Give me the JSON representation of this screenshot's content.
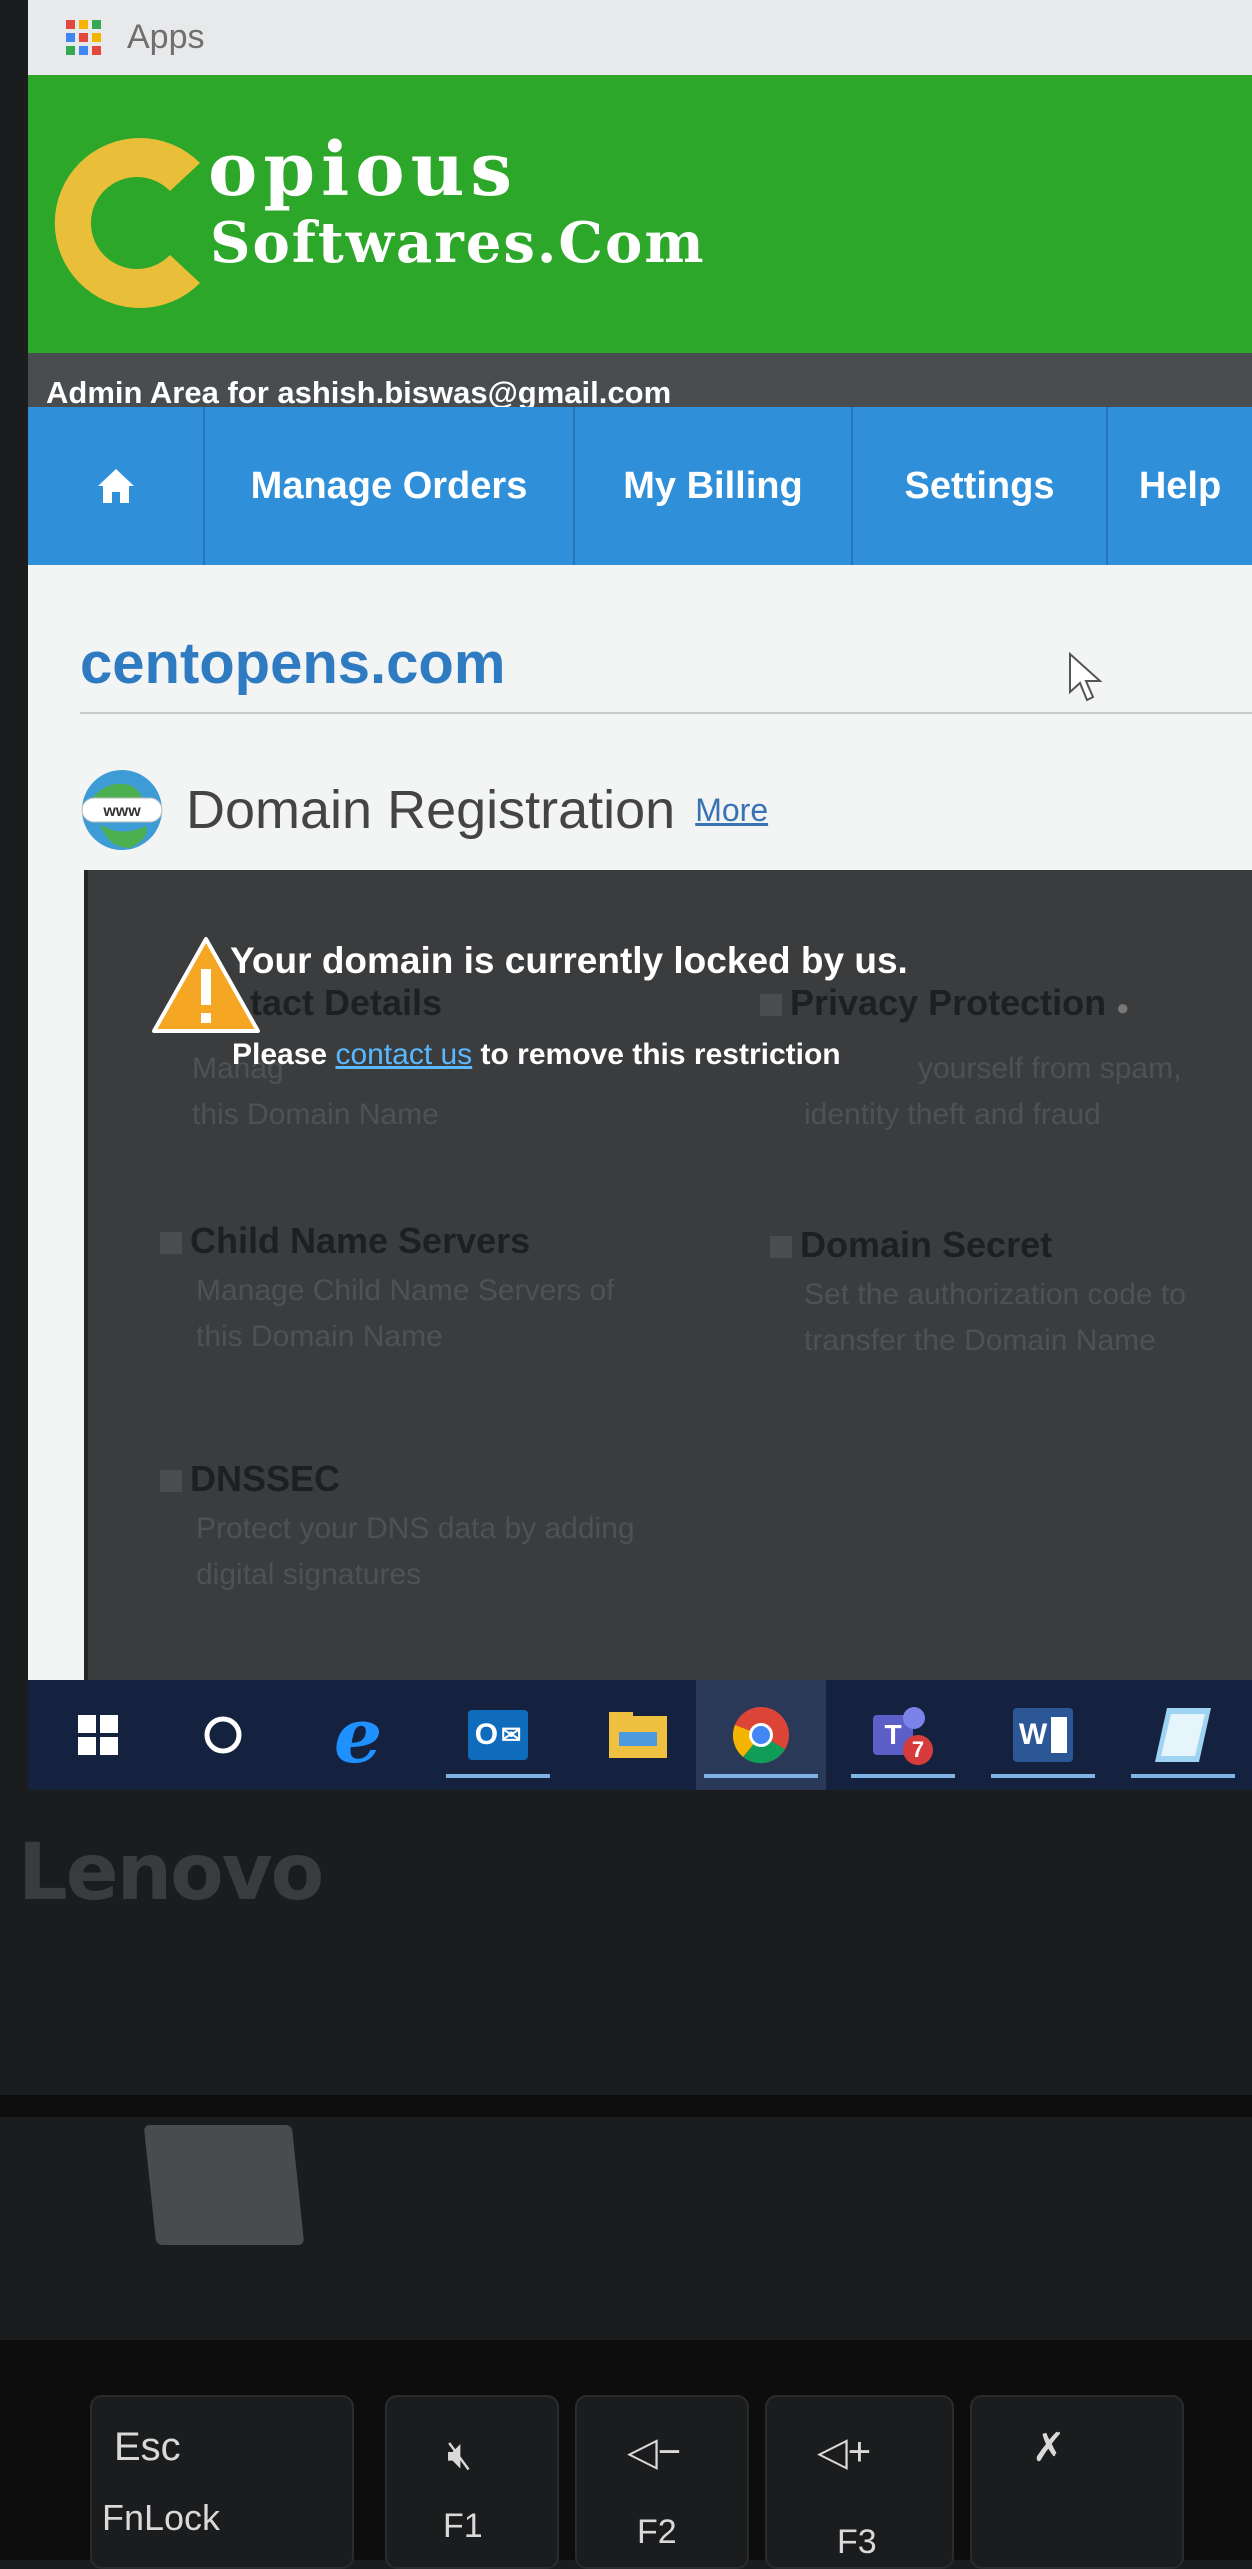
{
  "browser": {
    "apps_label": "Apps"
  },
  "site": {
    "logo_text_1": "opious",
    "logo_text_2": "Softwares.Com",
    "admin_area": "Admin Area for ashish.biswas@gmail.com"
  },
  "nav": {
    "home_icon": "home-icon",
    "items": [
      {
        "label": "Manage Orders"
      },
      {
        "label": "My Billing"
      },
      {
        "label": "Settings"
      },
      {
        "label": "Help"
      }
    ]
  },
  "main": {
    "domain_name": "centopens.com",
    "section_title": "Domain Registration",
    "more_link": "More"
  },
  "lock_notice": {
    "title": "Your domain is currently locked by us.",
    "please": "Please",
    "contact_link": "contact us",
    "rest": "to remove this restriction"
  },
  "features": [
    {
      "title": "tact Details",
      "desc_1": "Manag",
      "desc_2": "this Domain Name"
    },
    {
      "title": "Privacy Protection",
      "desc_1": "yourself from spam,",
      "desc_2": "identity theft and fraud"
    },
    {
      "title": "Child Name Servers",
      "desc_1": "Manage Child Name Servers of",
      "desc_2": "this Domain Name"
    },
    {
      "title": "Domain Secret",
      "desc_1": "Set the authorization code to",
      "desc_2": "transfer the Domain Name"
    },
    {
      "title": "DNSSEC",
      "desc_1": "Protect your DNS data by adding",
      "desc_2": "digital signatures"
    }
  ],
  "taskbar": {
    "teams_badge": "7",
    "outlook_letter": "O",
    "word_letter": "W",
    "edge_letter": "e"
  },
  "laptop": {
    "brand": "Lenovo",
    "keys": [
      {
        "top": "Esc",
        "bottom": "FnLock"
      },
      {
        "bottom": "F1"
      },
      {
        "bottom": "F2"
      },
      {
        "bottom": "F3"
      }
    ]
  },
  "colors": {
    "banner_green": "#2da72a",
    "logo_yellow": "#e9bf3a",
    "nav_blue": "#2f8fd9",
    "link_blue": "#5ab8ff",
    "taskbar": "#14223f"
  }
}
